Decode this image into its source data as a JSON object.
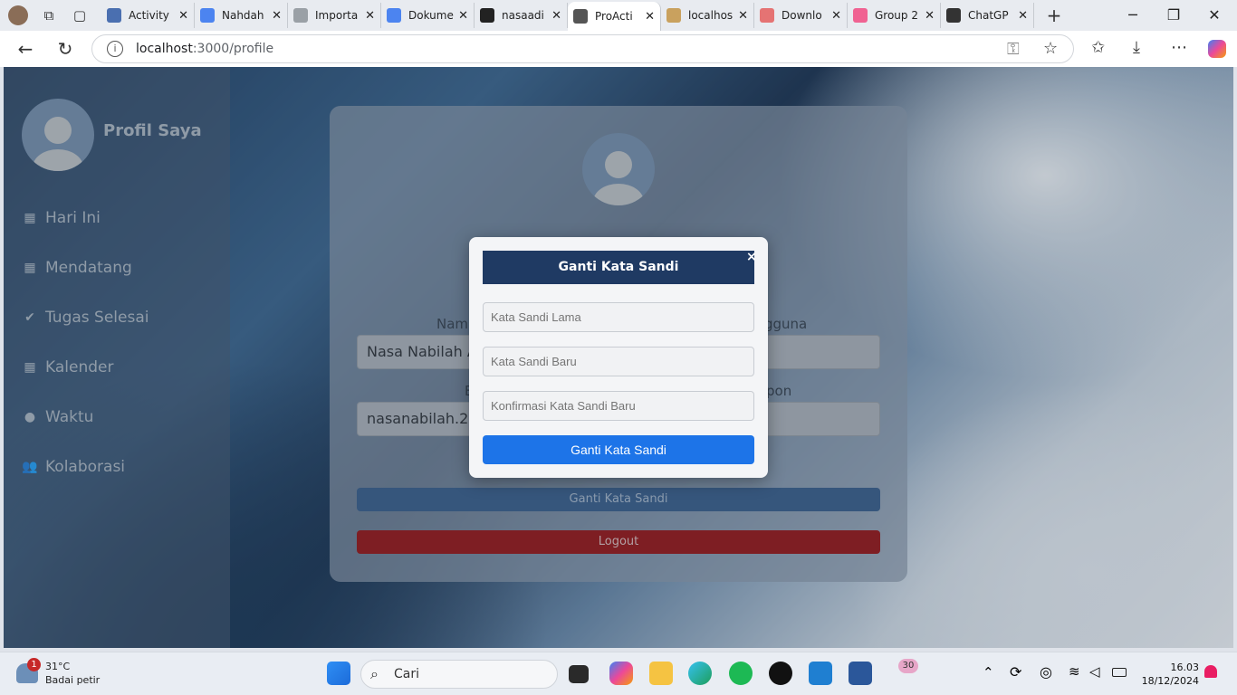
{
  "browser": {
    "tabs": [
      {
        "title": "Activity",
        "color": "#4a6fb0"
      },
      {
        "title": "Nahdah",
        "color": "#4c84f0"
      },
      {
        "title": "Importa",
        "color": "#9aa0a6"
      },
      {
        "title": "Dokume",
        "color": "#4c84f0"
      },
      {
        "title": "nasaadi",
        "color": "#222"
      },
      {
        "title": "ProActi",
        "color": "#555"
      },
      {
        "title": "localhos",
        "color": "#c9a15e"
      },
      {
        "title": "Downlo",
        "color": "#e57373"
      },
      {
        "title": "Group 2",
        "color": "#f06292"
      },
      {
        "title": "ChatGP",
        "color": "#333"
      }
    ],
    "active_tab": 5,
    "url_host": "localhost",
    "url_path": ":3000/profile"
  },
  "sidebar": {
    "title": "Profil Saya",
    "items": [
      {
        "label": "Hari Ini",
        "icon": "calendar-day-icon",
        "glyph": "▦"
      },
      {
        "label": "Mendatang",
        "icon": "calendar-icon",
        "glyph": "▦"
      },
      {
        "label": "Tugas Selesai",
        "icon": "check-icon",
        "glyph": "✔"
      },
      {
        "label": "Kalender",
        "icon": "calendar-alt-icon",
        "glyph": "▦"
      },
      {
        "label": "Waktu",
        "icon": "clock-icon",
        "glyph": "●"
      },
      {
        "label": "Kolaborasi",
        "icon": "users-icon",
        "glyph": "👥"
      }
    ]
  },
  "profile": {
    "name_label": "Nam",
    "name_value": "Nasa Nabilah Ad",
    "username_label": "gguna",
    "email_label": "E",
    "email_value": "nasanabilah.2200",
    "phone_label": "pon",
    "change_password_label": "Ganti Kata Sandi",
    "logout_label": "Logout"
  },
  "modal": {
    "title": "Ganti Kata Sandi",
    "close": "×",
    "old_placeholder": "Kata Sandi Lama",
    "new_placeholder": "Kata Sandi Baru",
    "confirm_placeholder": "Konfirmasi Kata Sandi Baru",
    "submit_label": "Ganti Kata Sandi"
  },
  "taskbar": {
    "weather_temp": "31°C",
    "weather_desc": "Badai petir",
    "weather_badge": "1",
    "search_label": "Cari",
    "notif_badge": "30",
    "time": "16.03",
    "date": "18/12/2024"
  }
}
